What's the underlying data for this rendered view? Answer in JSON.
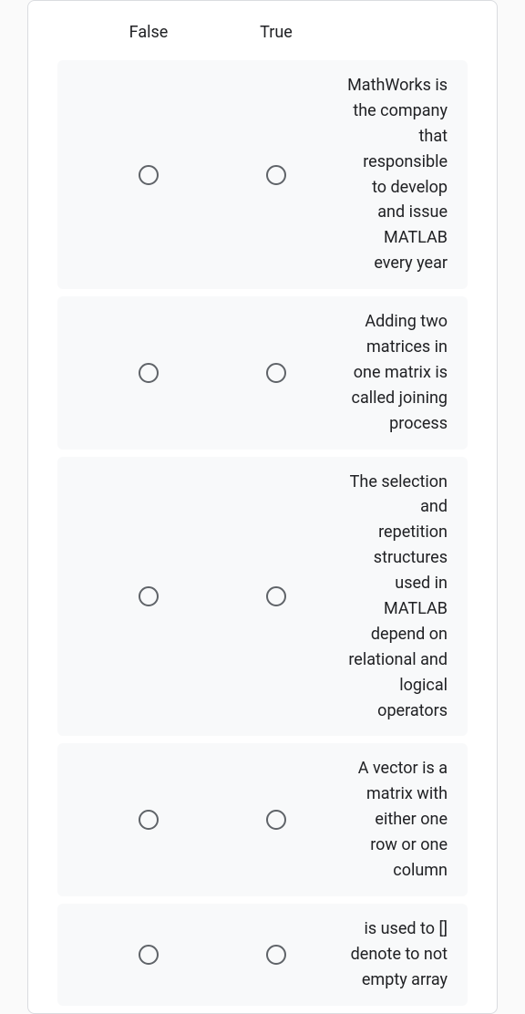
{
  "headers": {
    "false": "False",
    "true": "True"
  },
  "questions": [
    {
      "text": "MathWorks is the company that responsible to develop and issue MATLAB every year"
    },
    {
      "text": "Adding two matrices in one matrix is called joining process"
    },
    {
      "text": "The selection and repetition structures used in MATLAB depend on relational and logical operators"
    },
    {
      "text": "A vector is a matrix with either one row or one column"
    },
    {
      "text": "is used to [] denote to not empty array"
    }
  ]
}
